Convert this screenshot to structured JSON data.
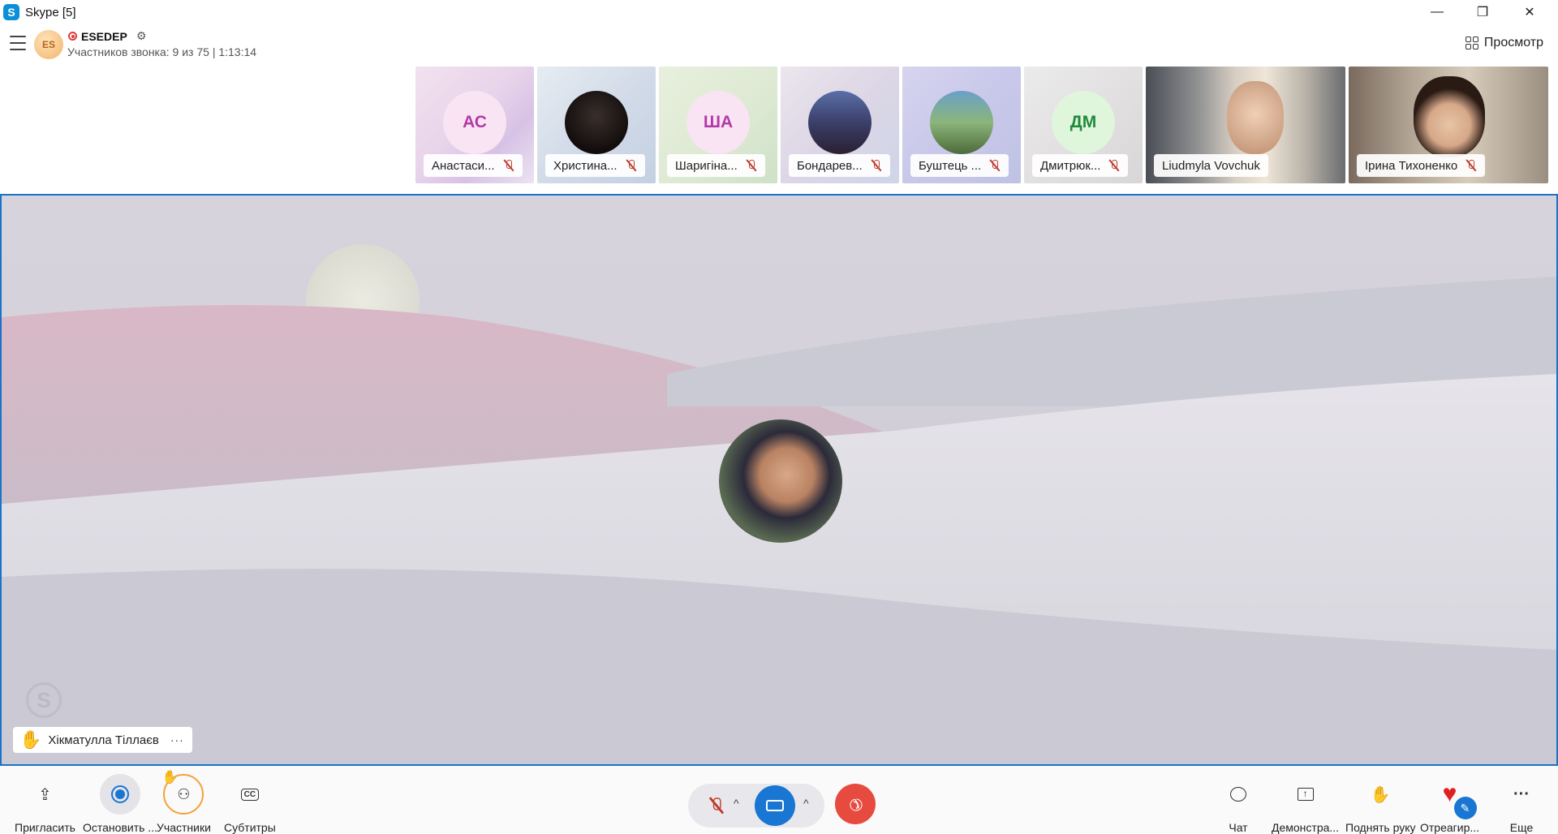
{
  "window": {
    "title": "Skype [5]",
    "minimize_glyph": "—",
    "maximize_glyph": "❐",
    "close_glyph": "✕"
  },
  "header": {
    "avatar_initials": "ES",
    "call_name": "ESEDEP",
    "call_status": "Участников звонка: 9 из 75 | 1:13:14",
    "view_label": "Просмотр"
  },
  "participants": [
    {
      "name": "Анастаси...",
      "initials": "АС",
      "muted": true
    },
    {
      "name": "Христина...",
      "initials": "",
      "muted": true
    },
    {
      "name": "Шаригіна...",
      "initials": "ША",
      "muted": true
    },
    {
      "name": "Бондарев...",
      "initials": "",
      "muted": true
    },
    {
      "name": "Буштець ...",
      "initials": "",
      "muted": true
    },
    {
      "name": "Дмитрюк...",
      "initials": "ДМ",
      "muted": true
    },
    {
      "name": "Liudmyla Vovchuk",
      "initials": "",
      "muted": false
    },
    {
      "name": "Ірина Тихоненко",
      "initials": "",
      "muted": true
    }
  ],
  "stage": {
    "speaker_name": "Хікматулла Тіллаєв",
    "more_glyph": "···",
    "hand_icon": "raised-hand-icon"
  },
  "toolbar": {
    "invite": "Пригласить",
    "stop": "Остановить ...",
    "participants": "Участники",
    "subtitles": "Субтитры",
    "chat": "Чат",
    "share": "Демонстра...",
    "raise_hand": "Поднять руку",
    "react": "Отреагир...",
    "more": "Еще"
  },
  "colors": {
    "accent": "#1a73c9",
    "end_call": "#e74a3f",
    "record": "#e23b3b",
    "video_on": "#1976d2"
  }
}
